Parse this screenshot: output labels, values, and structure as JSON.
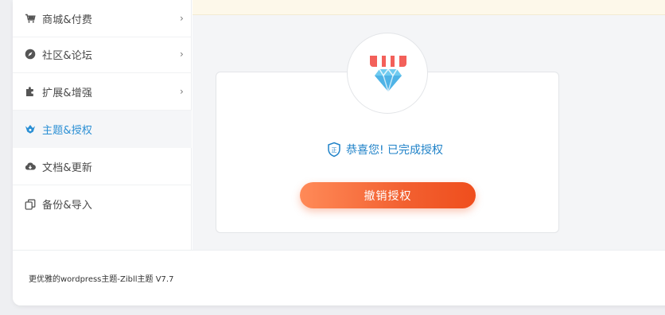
{
  "sidebar": {
    "items": [
      {
        "label": "商城&付费",
        "icon": "cart-icon",
        "has_submenu": true
      },
      {
        "label": "社区&论坛",
        "icon": "compass-icon",
        "has_submenu": true
      },
      {
        "label": "扩展&增强",
        "icon": "puzzle-icon",
        "has_submenu": true
      },
      {
        "label": "主题&授权",
        "icon": "theme-icon",
        "has_submenu": false,
        "active": true
      },
      {
        "label": "文档&更新",
        "icon": "cloud-download-icon",
        "has_submenu": false
      },
      {
        "label": "备份&导入",
        "icon": "copy-icon",
        "has_submenu": false
      }
    ],
    "chevron": "›"
  },
  "license": {
    "status_text": "恭喜您! 已完成授权",
    "revoke_button": "撤销授权",
    "badge_icon": "diamond-shop-icon"
  },
  "footer": {
    "text": "更优雅的wordpress主题-Zibll主题 V7.7"
  },
  "colors": {
    "accent": "#2a8fd4",
    "success_text": "#1f82c8",
    "button_gradient_start": "#ff8a58",
    "button_gradient_end": "#ef4e1d",
    "notice_bar": "#fdf8ea"
  }
}
